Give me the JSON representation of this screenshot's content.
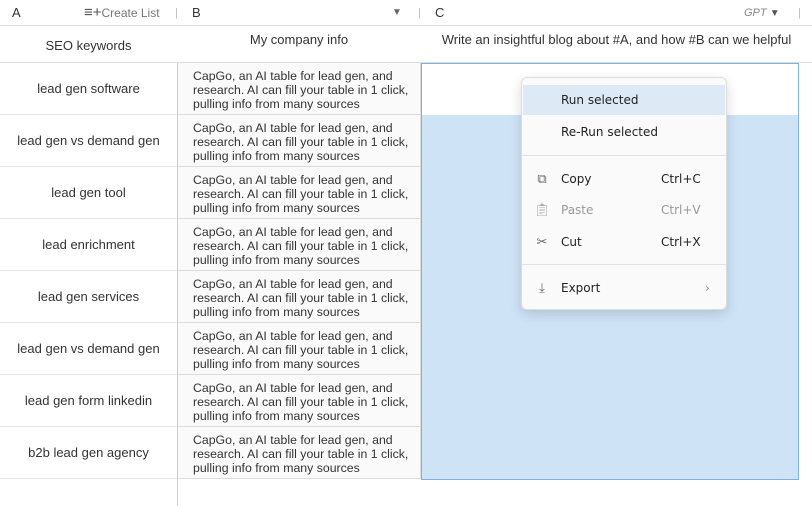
{
  "columns": {
    "a": "A",
    "b": "B",
    "c": "C",
    "create_list": "Create List",
    "model": "GPT"
  },
  "headers": {
    "a": "SEO keywords",
    "b": "My company info",
    "c": "Write an insightful blog about #A, and how #B can we helpful"
  },
  "rows": [
    {
      "keyword": "lead gen software",
      "info": "CapGo, an AI table for lead gen, and research. AI can fill your table in 1 click, pulling info from many sources"
    },
    {
      "keyword": "lead gen vs demand gen",
      "info": "CapGo, an AI table for lead gen, and research. AI can fill your table in 1 click, pulling info from many sources"
    },
    {
      "keyword": "lead gen tool",
      "info": "CapGo, an AI table for lead gen, and research. AI can fill your table in 1 click, pulling info from many sources"
    },
    {
      "keyword": "lead enrichment",
      "info": "CapGo, an AI table for lead gen, and research. AI can fill your table in 1 click, pulling info from many sources"
    },
    {
      "keyword": "lead gen services",
      "info": "CapGo, an AI table for lead gen, and research. AI can fill your table in 1 click, pulling info from many sources"
    },
    {
      "keyword": "lead gen vs demand gen",
      "info": "CapGo, an AI table for lead gen, and research. AI can fill your table in 1 click, pulling info from many sources"
    },
    {
      "keyword": "lead gen form linkedin",
      "info": "CapGo, an AI table for lead gen, and research. AI can fill your table in 1 click, pulling info from many sources"
    },
    {
      "keyword": "b2b lead gen agency",
      "info": "CapGo, an AI table for lead gen, and research. AI can fill your table in 1 click, pulling info from many sources"
    }
  ],
  "menu": {
    "run": "Run selected",
    "rerun": "Re-Run selected",
    "copy": "Copy",
    "copy_sc": "Ctrl+C",
    "paste": "Paste",
    "paste_sc": "Ctrl+V",
    "cut": "Cut",
    "cut_sc": "Ctrl+X",
    "export": "Export"
  },
  "colors": {
    "selection": "#cfe3f7",
    "selection_border": "#7fb0e0",
    "menu_hover": "#dde9f5"
  }
}
